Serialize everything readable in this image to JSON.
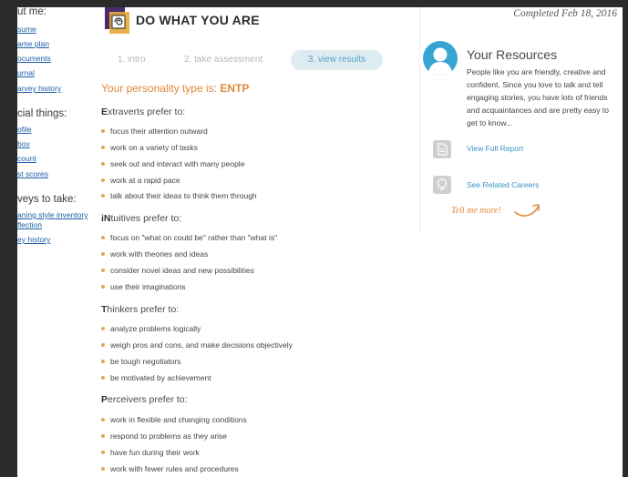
{
  "sidebar": {
    "top_head": "ut me:",
    "top_links": [
      "sume",
      "ame plan",
      "ocuments",
      "urnal",
      "arvey history"
    ],
    "social_head": "cial things:",
    "social_links": [
      "ofile",
      "box",
      "count",
      "st scores"
    ],
    "surveys_head": "veys to take:",
    "survey_links": [
      "aning style inventory",
      "flection",
      "ey history"
    ]
  },
  "logo": {
    "text": "DO WHAT YOU ARE"
  },
  "steps": [
    "1. intro",
    "2. take assessment",
    "3. view results"
  ],
  "personality": {
    "label": "Your personality type is:",
    "type": "ENTP"
  },
  "sections": [
    {
      "initial": "E",
      "rest": "xtraverts prefer to:",
      "items": [
        "focus their attention outward",
        "work on a variety of tasks",
        "seek out and interact with many people",
        "work at a rapid pace",
        "talk about their ideas to think them through"
      ]
    },
    {
      "initial": "iN",
      "rest": "tuitives prefer to:",
      "items": [
        "focus on \"what on could be\" rather than \"what is\"",
        "work with theories and ideas",
        "consider novel ideas and new possibilities",
        "use their imaginations"
      ]
    },
    {
      "initial": "T",
      "rest": "hinkers prefer to:",
      "items": [
        "analyze problems logically",
        "weigh pros and cons, and make decisions objectively",
        "be tough negotiators",
        "be motivated by achievement"
      ]
    },
    {
      "initial": "P",
      "rest": "erceivers prefer to:",
      "items": [
        "work in flexible and changing conditions",
        "respond to problems as they arise",
        "have fun during their work",
        "work with fewer rules and procedures"
      ]
    }
  ],
  "resources": {
    "completed": "Completed Feb 18, 2016",
    "title": "Your Resources",
    "description": "People like you are friendly, creative and confident. Since you love to talk and tell engaging stories, you have lots of friends and acquaintances and are pretty easy to get to know...",
    "full_report": "View Full Report",
    "careers": "See Related Careers",
    "tell_me": "Tell me more!"
  },
  "colors": {
    "accent": "#e0883a",
    "link": "#3b93c5",
    "avatar": "#36a5d4",
    "bullet": "#e8a552"
  },
  "icons": [
    "logo-mark-icon",
    "avatar-icon",
    "document-icon",
    "lightbulb-icon",
    "arrow-icon"
  ]
}
